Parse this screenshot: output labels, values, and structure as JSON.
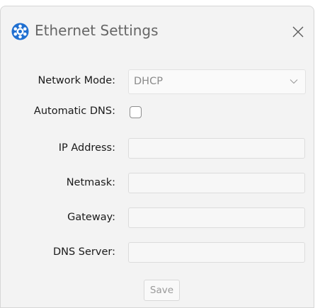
{
  "window": {
    "title": "Ethernet Settings",
    "app_icon": "network-logo-icon",
    "close_icon": "close-icon"
  },
  "form": {
    "network_mode": {
      "label": "Network Mode:",
      "value": "DHCP",
      "icon": "chevron-down-icon"
    },
    "automatic_dns": {
      "label": "Automatic DNS:",
      "checked": false
    },
    "ip_address": {
      "label": "IP Address:",
      "value": ""
    },
    "netmask": {
      "label": "Netmask:",
      "value": ""
    },
    "gateway": {
      "label": "Gateway:",
      "value": ""
    },
    "dns_server": {
      "label": "DNS Server:",
      "value": ""
    },
    "save_label": "Save"
  },
  "colors": {
    "accent": "#1f6fd1",
    "background": "#f3f3f3"
  }
}
